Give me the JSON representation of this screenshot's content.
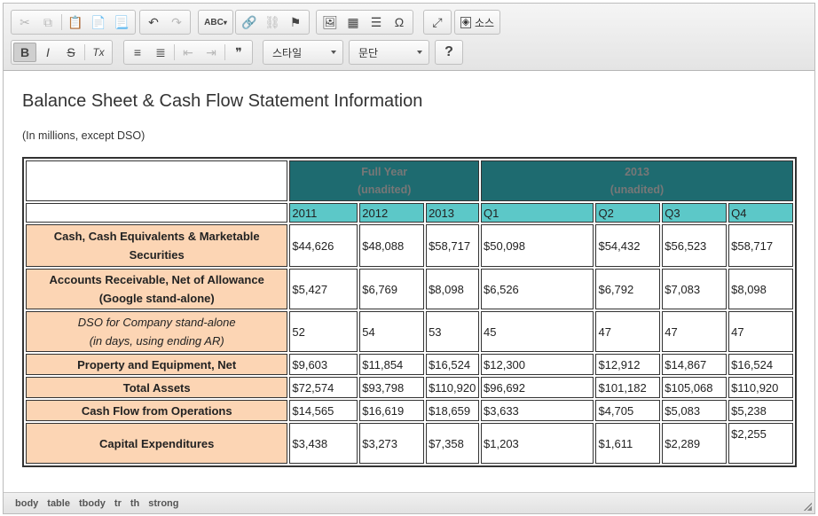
{
  "toolbar": {
    "row1": [
      {
        "name": "cut-button",
        "icon": "scissors-icon",
        "glyph": "✂",
        "disabled": true
      },
      {
        "name": "copy-button",
        "icon": "copy-icon",
        "glyph": "⧉",
        "disabled": true
      },
      {
        "name": "paste-button",
        "icon": "paste-icon",
        "glyph": "📋",
        "disabled": false
      },
      {
        "name": "paste-text-button",
        "icon": "paste-text-icon",
        "glyph": "📄",
        "disabled": false
      },
      {
        "name": "paste-word-button",
        "icon": "paste-word-icon",
        "glyph": "📃",
        "disabled": false
      }
    ],
    "history": [
      {
        "name": "undo-button",
        "icon": "undo-icon",
        "glyph": "↶",
        "disabled": false
      },
      {
        "name": "redo-button",
        "icon": "redo-icon",
        "glyph": "↷",
        "disabled": true
      }
    ],
    "spell_label": "ABC",
    "links": [
      {
        "name": "link-button",
        "icon": "link-icon",
        "glyph": "🔗",
        "disabled": false
      },
      {
        "name": "unlink-button",
        "icon": "unlink-icon",
        "glyph": "⛓",
        "disabled": true
      },
      {
        "name": "anchor-button",
        "icon": "flag-icon",
        "glyph": "⚑",
        "disabled": false
      }
    ],
    "insert": [
      {
        "name": "image-button",
        "icon": "image-icon",
        "glyph": "🖼",
        "disabled": false
      },
      {
        "name": "table-button",
        "icon": "table-icon",
        "glyph": "▦",
        "disabled": false
      },
      {
        "name": "hr-button",
        "icon": "horizontal-rule-icon",
        "glyph": "☰",
        "disabled": false
      },
      {
        "name": "special-char-button",
        "icon": "omega-icon",
        "glyph": "Ω",
        "disabled": false
      }
    ],
    "maximize_glyph": "⤢",
    "source_label": "소스",
    "row2_basic": [
      {
        "name": "bold-button",
        "icon": "bold-icon",
        "glyph": "B",
        "active": true
      },
      {
        "name": "italic-button",
        "icon": "italic-icon",
        "glyph": "I",
        "active": false
      },
      {
        "name": "strike-button",
        "icon": "strikethrough-icon",
        "glyph": "S",
        "active": false
      },
      {
        "name": "remove-format-button",
        "icon": "remove-format-icon",
        "glyph": "Tx",
        "active": false
      }
    ],
    "row2_lists": [
      {
        "name": "numbered-list-button",
        "icon": "numbered-list-icon",
        "glyph": "≡",
        "disabled": false
      },
      {
        "name": "bulleted-list-button",
        "icon": "bulleted-list-icon",
        "glyph": "≣",
        "disabled": false
      },
      {
        "name": "outdent-button",
        "icon": "outdent-icon",
        "glyph": "⇤",
        "disabled": true
      },
      {
        "name": "indent-button",
        "icon": "indent-icon",
        "glyph": "⇥",
        "disabled": true
      },
      {
        "name": "blockquote-button",
        "icon": "quote-icon",
        "glyph": "❞",
        "disabled": false
      }
    ],
    "style_combo": "스타일",
    "format_combo": "문단",
    "help_glyph": "?"
  },
  "document": {
    "title": "Balance Sheet & Cash Flow Statement Information",
    "subtitle": "(In millions, except DSO)"
  },
  "table": {
    "group_headers": [
      {
        "line1": "Full Year",
        "line2": "(unadited)"
      },
      {
        "line1": "2013",
        "line2": "(unadited)"
      }
    ],
    "columns": [
      "2011",
      "2012",
      "2013",
      "Q1",
      "Q2",
      "Q3",
      "Q4"
    ],
    "rows": [
      {
        "label1": "Cash, Cash Equivalents & Marketable",
        "label2": "Securities",
        "italic": false,
        "values": [
          "$44,626",
          "$48,088",
          "$58,717",
          "$50,098",
          "$54,432",
          "$56,523",
          "$58,717"
        ]
      },
      {
        "label1": "Accounts Receivable, Net of Allowance",
        "label2": "(Google stand-alone)",
        "italic": false,
        "values": [
          "$5,427",
          "$6,769",
          "$8,098",
          "$6,526",
          "$6,792",
          "$7,083",
          "$8,098"
        ]
      },
      {
        "label1": "DSO for Company stand-alone",
        "label2": "(in days, using ending AR)",
        "italic": true,
        "values": [
          "52",
          "54",
          "53",
          "45",
          "47",
          "47",
          "47"
        ]
      },
      {
        "label1": "Property and Equipment, Net",
        "label2": "",
        "italic": false,
        "values": [
          "$9,603",
          "$11,854",
          "$16,524",
          "$12,300",
          "$12,912",
          "$14,867",
          "$16,524"
        ]
      },
      {
        "label1": "Total Assets",
        "label2": "",
        "italic": false,
        "values": [
          "$72,574",
          "$93,798",
          "$110,920",
          "$96,692",
          "$101,182",
          "$105,068",
          "$110,920"
        ]
      },
      {
        "label1": "Cash Flow from Operations",
        "label2": "",
        "italic": false,
        "values": [
          "$14,565",
          "$16,619",
          "$18,659",
          "$3,633",
          "$4,705",
          "$5,083",
          "$5,238"
        ]
      },
      {
        "label1": "Capital Expenditures",
        "label2": "",
        "italic": false,
        "values": [
          "$3,438",
          "$3,273",
          "$7,358",
          "$1,203",
          "$1,611",
          "$2,289",
          "$2,255"
        ]
      }
    ]
  },
  "statusbar": {
    "path": [
      "body",
      "table",
      "tbody",
      "tr",
      "th",
      "strong"
    ]
  }
}
